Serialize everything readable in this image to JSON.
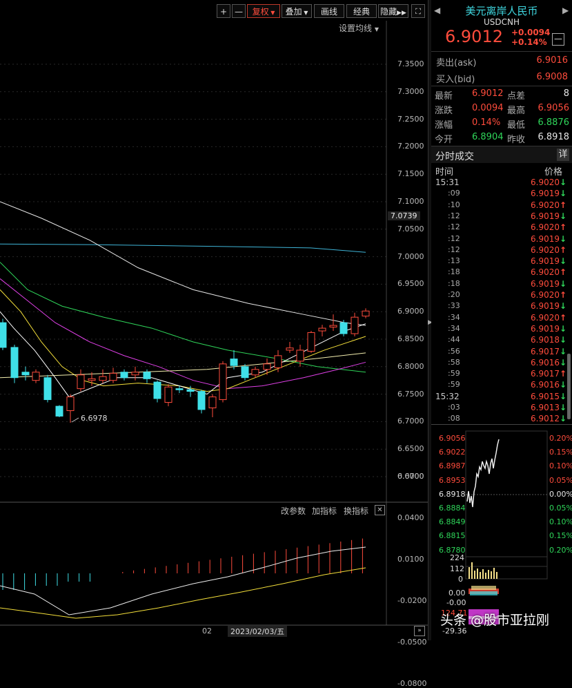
{
  "toolbar": {
    "plus": "+",
    "minus": "—",
    "fuquan": "复权",
    "diejia": "叠加",
    "huaxian": "画线",
    "jingdian": "经典",
    "yincang": "隐藏",
    "fullscreen_icon": "expand-icon"
  },
  "settings_label": "设置均线",
  "price_axis": [
    "7.3500",
    "7.3000",
    "7.2500",
    "7.2000",
    "7.1500",
    "7.1000",
    "7.0500",
    "7.0000",
    "6.9500",
    "6.9000",
    "6.8500",
    "6.8000",
    "6.7500",
    "6.7000",
    "6.6500",
    "6.6000"
  ],
  "current_axis_marker": "7.0739",
  "low_annotation": "6.6978",
  "sub_panel": {
    "btn_params": "改参数",
    "btn_add": "加指标",
    "btn_switch": "换指标",
    "axis": [
      "0.0700",
      "0.0400",
      "0.0100",
      "-0.0200",
      "-0.0500",
      "-0.0800"
    ]
  },
  "bottom_axis": {
    "tick": "02",
    "date": "2023/02/03/五"
  },
  "quote": {
    "title": "美元离岸人民币",
    "code": "USDCNH",
    "price": "6.9012",
    "change": "+0.0094",
    "change_pct": "+0.14%",
    "ask_label": "卖出(ask)",
    "ask": "6.9016",
    "bid_label": "买入(bid)",
    "bid": "6.9008",
    "stats": [
      {
        "l1": "最新",
        "v1": "6.9012",
        "c1": "red",
        "l2": "点差",
        "v2": "8",
        "c2": "white"
      },
      {
        "l1": "涨跌",
        "v1": "0.0094",
        "c1": "red",
        "l2": "最高",
        "v2": "6.9056",
        "c2": "red"
      },
      {
        "l1": "涨幅",
        "v1": "0.14%",
        "c1": "red",
        "l2": "最低",
        "v2": "6.8876",
        "c2": "green"
      },
      {
        "l1": "今开",
        "v1": "6.8904",
        "c1": "green",
        "l2": "昨收",
        "v2": "6.8918",
        "c2": "white"
      }
    ]
  },
  "ticks": {
    "title": "分时成交",
    "detail": "详",
    "col_time": "时间",
    "col_price": "价格",
    "rows": [
      {
        "t": "15:31",
        "p": "6.9020",
        "d": "down",
        "full": true
      },
      {
        "t": ":09",
        "p": "6.9019",
        "d": "down"
      },
      {
        "t": ":10",
        "p": "6.9020",
        "d": "up"
      },
      {
        "t": ":12",
        "p": "6.9019",
        "d": "down"
      },
      {
        "t": ":12",
        "p": "6.9020",
        "d": "up"
      },
      {
        "t": ":12",
        "p": "6.9019",
        "d": "down"
      },
      {
        "t": ":12",
        "p": "6.9020",
        "d": "up"
      },
      {
        "t": ":13",
        "p": "6.9019",
        "d": "down"
      },
      {
        "t": ":18",
        "p": "6.9020",
        "d": "up"
      },
      {
        "t": ":18",
        "p": "6.9019",
        "d": "down"
      },
      {
        "t": ":20",
        "p": "6.9020",
        "d": "up"
      },
      {
        "t": ":33",
        "p": "6.9019",
        "d": "down"
      },
      {
        "t": ":34",
        "p": "6.9020",
        "d": "up"
      },
      {
        "t": ":34",
        "p": "6.9019",
        "d": "down"
      },
      {
        "t": ":44",
        "p": "6.9018",
        "d": "down"
      },
      {
        "t": ":56",
        "p": "6.9017",
        "d": "down"
      },
      {
        "t": ":58",
        "p": "6.9016",
        "d": "down"
      },
      {
        "t": ":59",
        "p": "6.9017",
        "d": "up"
      },
      {
        "t": ":59",
        "p": "6.9016",
        "d": "down"
      },
      {
        "t": "15:32",
        "p": "6.9015",
        "d": "down",
        "full": true
      },
      {
        "t": ":03",
        "p": "6.9013",
        "d": "down"
      },
      {
        "t": ":08",
        "p": "6.9012",
        "d": "down"
      }
    ]
  },
  "mini_chart": {
    "left_labels": [
      {
        "v": "6.9056",
        "c": "red"
      },
      {
        "v": "6.9022",
        "c": "red"
      },
      {
        "v": "6.8987",
        "c": "red"
      },
      {
        "v": "6.8953",
        "c": "red"
      },
      {
        "v": "6.8918",
        "c": "white"
      },
      {
        "v": "6.8884",
        "c": "green"
      },
      {
        "v": "6.8849",
        "c": "green"
      },
      {
        "v": "6.8815",
        "c": "green"
      },
      {
        "v": "6.8780",
        "c": "green"
      }
    ],
    "right_labels": [
      {
        "v": "0.20%",
        "c": "red"
      },
      {
        "v": "0.15%",
        "c": "red"
      },
      {
        "v": "0.10%",
        "c": "red"
      },
      {
        "v": "0.05%",
        "c": "red"
      },
      {
        "v": "0.00%",
        "c": "white"
      },
      {
        "v": "0.05%",
        "c": "green"
      },
      {
        "v": "0.10%",
        "c": "green"
      },
      {
        "v": "0.15%",
        "c": "green"
      },
      {
        "v": "0.20%",
        "c": "green"
      }
    ],
    "vol_labels": [
      "224",
      "112",
      "0"
    ],
    "ind_labels": [
      "0.00",
      "-0.00"
    ],
    "ind2_labels": [
      "124.71",
      "-29.36"
    ]
  },
  "watermark": "头条 @股市亚拉刚",
  "colors": {
    "up": "#ff4c3c",
    "down": "#3fe0e8",
    "green": "#2fd65a"
  }
}
